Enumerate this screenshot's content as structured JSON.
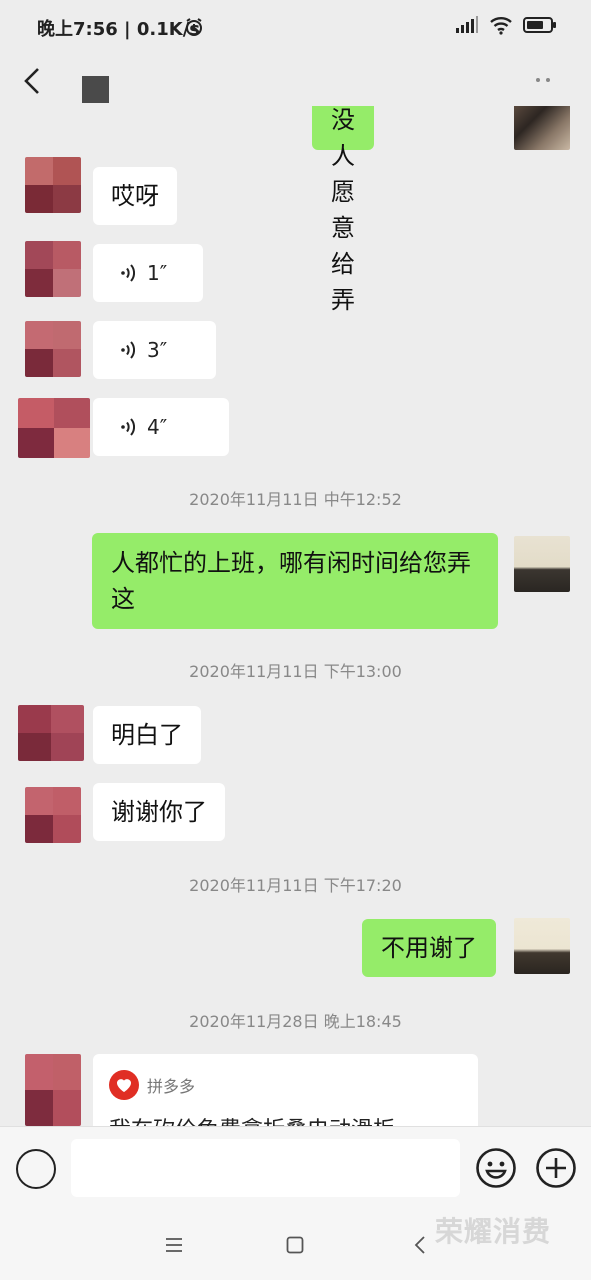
{
  "status_bar": {
    "time": "晚上7:56 | 0.1K/s",
    "icons": [
      "alarm-icon",
      "signal-icon",
      "wifi-icon",
      "battery-icon"
    ]
  },
  "header": {
    "back_icon": "chevron-left-icon",
    "more_icon": "more-dots-icon"
  },
  "messages": [
    {
      "side": "out",
      "text": "没人愿意给弄"
    },
    {
      "side": "in",
      "text": "哎呀"
    },
    {
      "side": "in",
      "type": "voice",
      "duration": "1″"
    },
    {
      "side": "in",
      "type": "voice",
      "duration": "3″"
    },
    {
      "side": "in",
      "type": "voice",
      "duration": "4″"
    },
    {
      "type": "time",
      "text": "2020年11月11日 中午12:52"
    },
    {
      "side": "out",
      "text": "人都忙的上班，哪有闲时间给您弄这"
    },
    {
      "type": "time",
      "text": "2020年11月11日 下午13:00"
    },
    {
      "side": "in",
      "text": "明白了"
    },
    {
      "side": "in",
      "text": "谢谢你了"
    },
    {
      "type": "time",
      "text": "2020年11月11日 下午17:20"
    },
    {
      "side": "out",
      "text": "不用谢了"
    },
    {
      "type": "time",
      "text": "2020年11月28日 晚上18:45"
    }
  ],
  "share_card": {
    "app_name": "拼多多",
    "title": "我在砍价免费拿折叠电动滑板"
  },
  "input_bar": {
    "value": "",
    "icons": [
      "voice-toggle-icon",
      "emoji-icon",
      "plus-icon"
    ]
  },
  "nav_bar": {
    "icons": [
      "menu-icon",
      "home-icon",
      "back-icon"
    ]
  },
  "watermark": "荣耀消费"
}
